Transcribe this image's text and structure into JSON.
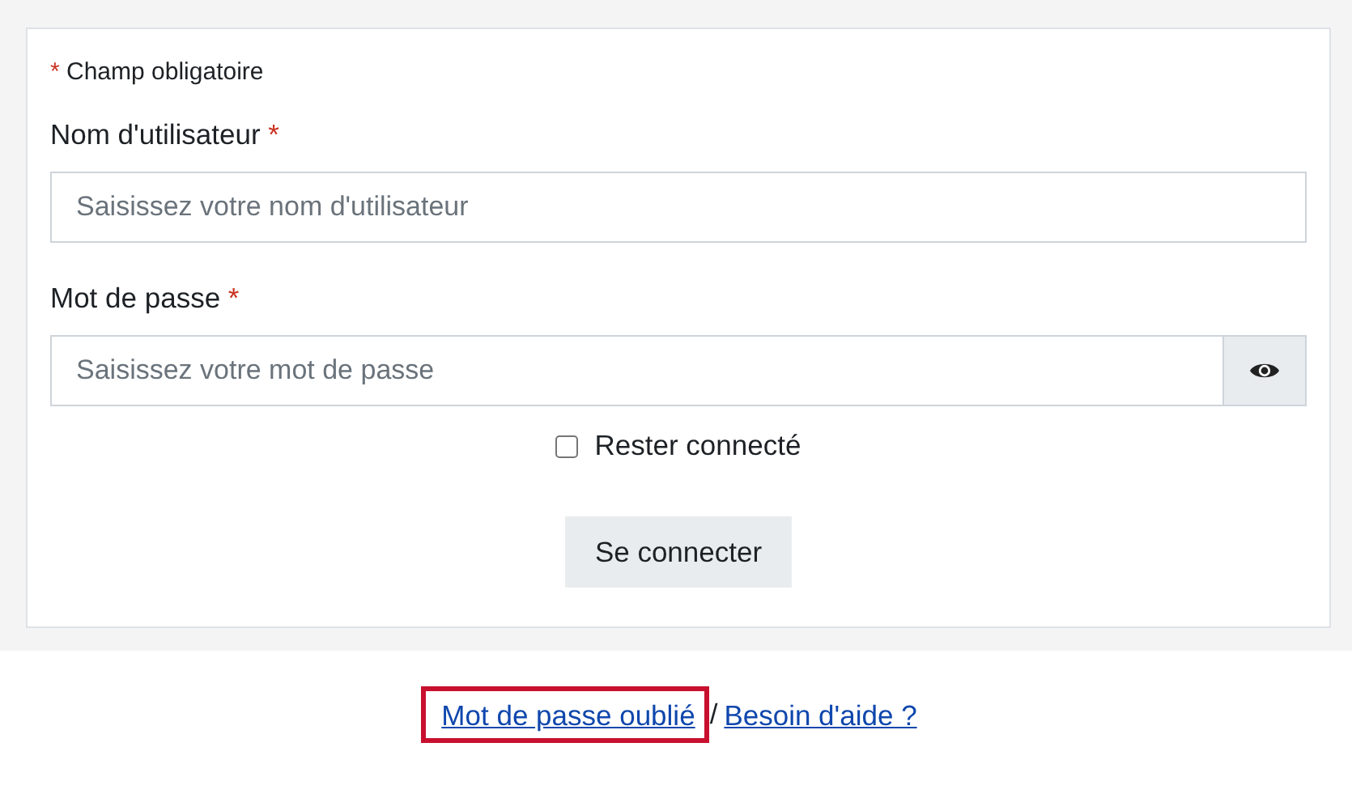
{
  "required_note": {
    "mark": "*",
    "text": "Champ obligatoire"
  },
  "fields": [
    {
      "label": "Nom d'utilisateur",
      "required_mark": "*",
      "placeholder": "Saisissez votre nom d'utilisateur",
      "kind": "text"
    },
    {
      "label": "Mot de passe",
      "required_mark": "*",
      "placeholder": "Saisissez votre mot de passe",
      "kind": "password"
    }
  ],
  "remember": {
    "label": "Rester connecté",
    "checked": false
  },
  "submit": "Se connecter",
  "links": [
    {
      "label": "Mot de passe oublié",
      "highlighted": true
    },
    {
      "label": "Besoin d'aide ?",
      "highlighted": false
    }
  ],
  "link_separator": "/"
}
